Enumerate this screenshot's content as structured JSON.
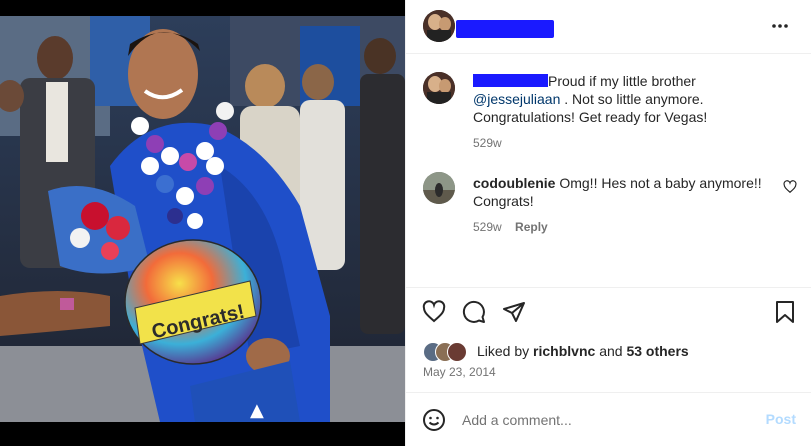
{
  "post": {
    "caption": {
      "text_before_mention": "Proud if my little brother",
      "mention": "@jessejuliaan",
      "text_after_mention": ". Not so little anymore. Congratulations! Get ready for Vegas!",
      "age": "529w"
    },
    "comments": [
      {
        "username": "codoublenie",
        "text": "Omg!! Hes not a baby anymore!! Congrats!",
        "age": "529w",
        "reply_label": "Reply",
        "like_icon": "heart-outline-icon"
      }
    ],
    "likes": {
      "liked_by_prefix": "Liked by",
      "liked_by_user": "richblvnc",
      "and_label": "and",
      "others_label": "53 others"
    },
    "date": "May 23, 2014",
    "add_comment": {
      "placeholder": "Add a comment...",
      "post_label": "Post"
    }
  },
  "photo": {
    "balloon_text": "Congrats!"
  },
  "colors": {
    "redaction": "#1a1aff",
    "gown": "#1f4fc9",
    "link": "#00376b",
    "muted": "#737373",
    "post_button": "#b3dbff"
  },
  "icons": [
    "more-icon",
    "heart-icon",
    "comment-icon",
    "share-icon",
    "bookmark-icon",
    "emoji-icon",
    "heart-outline-icon"
  ]
}
